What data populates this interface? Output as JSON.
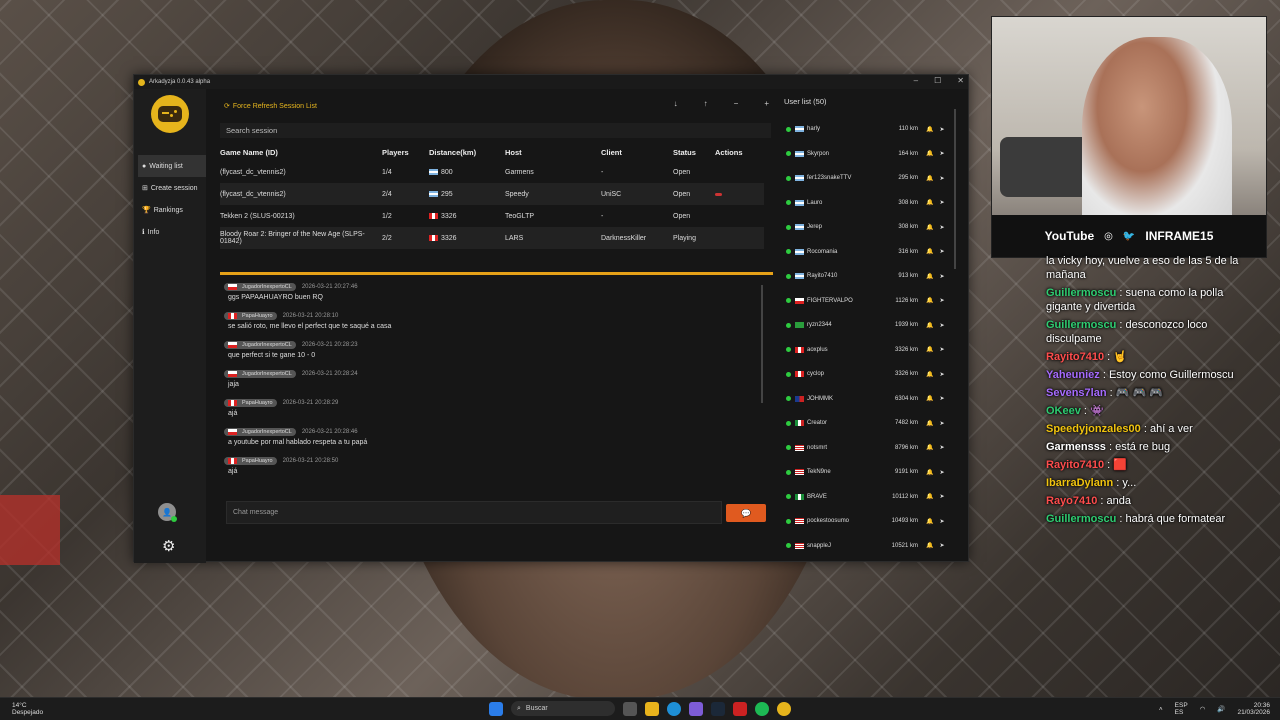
{
  "window": {
    "title": "Arkadyzja 0.0.43 alpha",
    "controls": [
      "–",
      "☐",
      "✕"
    ]
  },
  "sidebar": {
    "items": [
      {
        "icon": "circle-icon",
        "label": "Waiting list"
      },
      {
        "icon": "plus-square-icon",
        "label": "Create session"
      },
      {
        "icon": "trophy-icon",
        "label": "Rankings"
      },
      {
        "icon": "info-icon",
        "label": "Info"
      }
    ]
  },
  "toolbar": {
    "refresh_label": "Force Refresh Session List",
    "icons": [
      "↓",
      "↑",
      "−",
      "+"
    ]
  },
  "search": {
    "placeholder": "Search session"
  },
  "sessions": {
    "headers": [
      "Game Name (ID)",
      "Players",
      "Distance(km)",
      "Host",
      "Client",
      "Status",
      "Actions"
    ],
    "rows": [
      {
        "game": "(flycast_dc_vtennis2)",
        "players": "1/4",
        "flag": "ar",
        "distance": "800",
        "host": "Garmens",
        "client": "-",
        "status": "Open",
        "action": false
      },
      {
        "game": "(flycast_dc_vtennis2)",
        "players": "2/4",
        "flag": "ar",
        "distance": "295",
        "host": "Speedy",
        "client": "UniSC",
        "status": "Open",
        "action": true
      },
      {
        "game": "Tekken 2 (SLUS-00213)",
        "players": "1/2",
        "flag": "pe",
        "distance": "3326",
        "host": "TeoGLTP",
        "client": "-",
        "status": "Open",
        "action": false
      },
      {
        "game": "Bloody Roar 2: Bringer of the New Age (SLPS-01842)",
        "players": "2/2",
        "flag": "pe",
        "distance": "3326",
        "host": "LARS",
        "client": "DarknessKiller",
        "status": "Playing",
        "action": false
      }
    ]
  },
  "chat": {
    "messages": [
      {
        "user": "JugadorInexpertoCL",
        "flag": "cl",
        "time": "2026-03-21 20:27:46",
        "text": "ggs PAPAAHUAYRO buen RQ"
      },
      {
        "user": "PapaHuayro",
        "flag": "pe",
        "time": "2026-03-21 20:28:10",
        "text": "se salió roto, me llevo el perfect que te saqué a casa"
      },
      {
        "user": "JugadorInexpertoCL",
        "flag": "cl",
        "time": "2026-03-21 20:28:23",
        "text": "que perfect si te gane 10 - 0"
      },
      {
        "user": "JugadorInexpertoCL",
        "flag": "cl",
        "time": "2026-03-21 20:28:24",
        "text": "jaja"
      },
      {
        "user": "PapaHuayro",
        "flag": "pe",
        "time": "2026-03-21 20:28:29",
        "text": "ajá"
      },
      {
        "user": "JugadorInexpertoCL",
        "flag": "cl",
        "time": "2026-03-21 20:28:46",
        "text": "a youtube por mal hablado respeta a tu papá"
      },
      {
        "user": "PapaHuayro",
        "flag": "pe",
        "time": "2026-03-21 20:28:50",
        "text": "ajá"
      }
    ],
    "input_placeholder": "Chat message",
    "send_icon": "💬"
  },
  "users": {
    "header": "User list (50)",
    "list": [
      {
        "name": "harly",
        "flag": "ar",
        "km": "110 km"
      },
      {
        "name": "Skyrpon",
        "flag": "ar",
        "km": "164 km"
      },
      {
        "name": "fer123snakeTTV",
        "flag": "ar",
        "km": "295 km"
      },
      {
        "name": "Lauro",
        "flag": "ar",
        "km": "308 km"
      },
      {
        "name": "Jerep",
        "flag": "ar",
        "km": "308 km"
      },
      {
        "name": "Rocomania",
        "flag": "ar",
        "km": "316 km"
      },
      {
        "name": "Rayito7410",
        "flag": "ar",
        "km": "913 km"
      },
      {
        "name": "FIGHTERVALPO",
        "flag": "cl",
        "km": "1126 km"
      },
      {
        "name": "ryzn2344",
        "flag": "br",
        "km": "1939 km"
      },
      {
        "name": "aoxplus",
        "flag": "pe",
        "km": "3326 km"
      },
      {
        "name": "cyclop",
        "flag": "pe",
        "km": "3326 km"
      },
      {
        "name": "JOHMMK",
        "flag": "do",
        "km": "6304 km"
      },
      {
        "name": "Creator",
        "flag": "mx",
        "km": "7482 km"
      },
      {
        "name": "notsmrt",
        "flag": "us",
        "km": "8796 km"
      },
      {
        "name": "TekN9ne",
        "flag": "us",
        "km": "9191 km"
      },
      {
        "name": "BRAVE",
        "flag": "ng",
        "km": "10112 km"
      },
      {
        "name": "pockestoosumo",
        "flag": "us",
        "km": "10493 km"
      },
      {
        "name": "snappleJ",
        "flag": "us",
        "km": "10521 km"
      }
    ]
  },
  "stream": {
    "bar_items": [
      "YouTube",
      "◎",
      "🐦",
      "INFRAME15"
    ],
    "chat": [
      {
        "user": "",
        "color": "#ffffff",
        "text": "la vicky hoy, vuelve a eso de las 5 de la mañana"
      },
      {
        "user": "Guillermoscu",
        "color": "#2ecc71",
        "text": "suena como la polla gigante y divertida"
      },
      {
        "user": "Guillermoscu",
        "color": "#2ecc71",
        "text": "desconozco loco disculpame"
      },
      {
        "user": "Rayito7410",
        "color": "#ff4d4d",
        "text": "🤘"
      },
      {
        "user": "Yaheuniez",
        "color": "#a66bff",
        "text": "Estoy como Guillermoscu"
      },
      {
        "user": "Sevens7lan",
        "color": "#a66bff",
        "text": "🎮 🎮 🎮"
      },
      {
        "user": "OKeev",
        "color": "#2ecc71",
        "text": "👾"
      },
      {
        "user": "Speedyjonzales00",
        "color": "#f1c40f",
        "text": "ahí a ver"
      },
      {
        "user": "Garmensss",
        "color": "#ffffff",
        "text": "está re bug"
      },
      {
        "user": "Rayito7410",
        "color": "#ff4d4d",
        "text": "🟥"
      },
      {
        "user": "IbarraDylann",
        "color": "#f1c40f",
        "text": "y..."
      },
      {
        "user": "Rayo7410",
        "color": "#ff4d4d",
        "text": "anda"
      },
      {
        "user": "Guillermoscu",
        "color": "#2ecc71",
        "text": "habrá que formatear"
      }
    ]
  },
  "taskbar": {
    "weather_temp": "14°C",
    "weather_desc": "Despejado",
    "search": "Buscar",
    "lang": "ESP",
    "region": "ES",
    "time": "20:36",
    "date": "21/03/2026"
  }
}
